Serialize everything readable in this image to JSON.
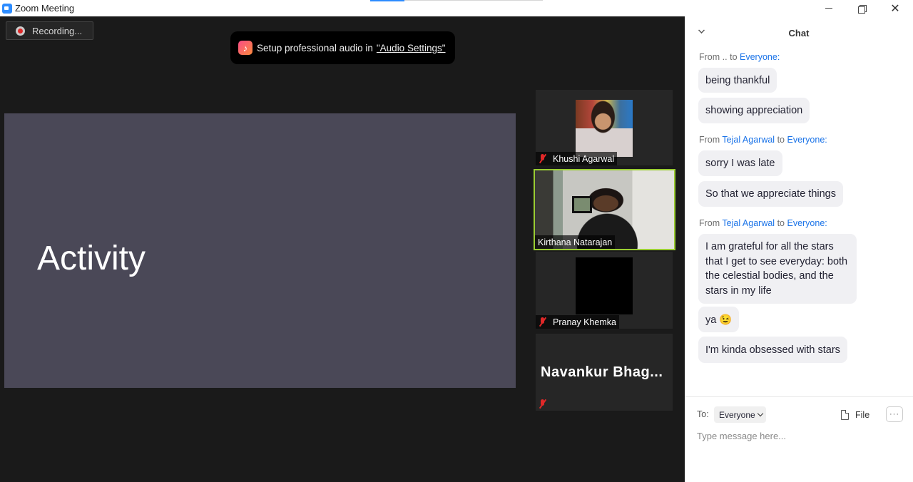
{
  "window": {
    "title": "Zoom Meeting",
    "app_icon": "zoom-camera-icon",
    "controls": {
      "minimize_icon": "minimize-icon",
      "maximize_icon": "restore-icon",
      "close_glyph": "✕"
    }
  },
  "meeting": {
    "recording_label": "Recording...",
    "toast": {
      "icon": "music-note-icon",
      "icon_glyph": "♪",
      "text": "Setup professional audio in",
      "link": "\"Audio Settings\""
    },
    "shared_screen": {
      "slide_title": "Activity",
      "background_color": "#4a4857"
    },
    "participants": [
      {
        "name": "Khushi Agarwal",
        "muted": true,
        "video": "photo"
      },
      {
        "name": "Kirthana Natarajan",
        "muted": false,
        "video": "camera",
        "active_speaker": true,
        "highlight_color": "#9acd32"
      },
      {
        "name": "Pranay Khemka",
        "muted": true,
        "video": "black"
      },
      {
        "name": "Navankur  Bhag...",
        "muted": true,
        "video": "none"
      }
    ]
  },
  "chat": {
    "title": "Chat",
    "messages": [
      {
        "from_prefix": "From",
        "sender": "..",
        "to_word": "to",
        "recipient": "Everyone:",
        "texts": [
          "being thankful",
          "showing appreciation"
        ]
      },
      {
        "from_prefix": "From",
        "sender": "Tejal Agarwal",
        "to_word": "to",
        "recipient": "Everyone:",
        "texts": [
          "sorry I was late",
          "So that we appreciate things"
        ]
      },
      {
        "from_prefix": "From",
        "sender": "Tejal Agarwal",
        "to_word": "to",
        "recipient": "Everyone:",
        "texts": [
          "I am grateful for all the stars that I get to see everyday: both the celestial bodies, and the stars in my life",
          "ya 😉",
          "I'm kinda obsessed with stars"
        ]
      }
    ],
    "compose": {
      "to_label": "To:",
      "to_value": "Everyone",
      "file_label": "File",
      "more_glyph": "···",
      "placeholder": "Type message here..."
    }
  }
}
